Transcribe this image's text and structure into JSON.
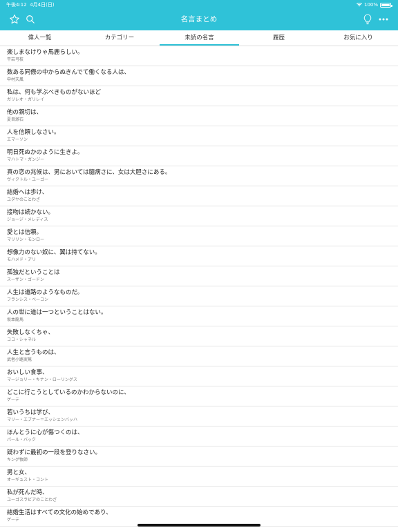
{
  "status_bar": {
    "time": "午後4:12",
    "date": "4月4日(日)",
    "battery": "100%"
  },
  "navbar": {
    "title": "名言まとめ"
  },
  "tabs": [
    "偉人一覧",
    "カテゴリー",
    "未読の名言",
    "履歴",
    "お気に入り"
  ],
  "selected_tab": "未読の名言",
  "quotes": [
    {
      "text": "楽しまなけりゃ馬鹿らしい。",
      "author": "平岩弓枝"
    },
    {
      "text": "数ある同僚の中からぬきんでて働くなる人は、",
      "author": "中村天風"
    },
    {
      "text": "私は、何も学ぶべきものがないほど",
      "author": "ガリレオ・ガリレイ"
    },
    {
      "text": "他の親切は、",
      "author": "夏目漱石"
    },
    {
      "text": "人を信頼しなさい。",
      "author": "エマーソン"
    },
    {
      "text": "明日死ぬかのように生きよ。",
      "author": "マハトマ・ガンジー"
    },
    {
      "text": "真の恋の兆候は、男においては臆病さに、女は大胆さにある。",
      "author": "ヴィクトル・ユーゴー"
    },
    {
      "text": "結婚へは歩け、",
      "author": "ユダヤのことわざ"
    },
    {
      "text": "接吻は続かない。",
      "author": "ジョージ・メレディス"
    },
    {
      "text": "愛とは信頼。",
      "author": "マリリン・モンロー"
    },
    {
      "text": "想像力のない奴に、翼は持てない。",
      "author": "モハメド・アリ"
    },
    {
      "text": "孤独だということは",
      "author": "スーザン・ゴードン"
    },
    {
      "text": "人生は道路のようなものだ。",
      "author": "フランシス・ベーコン"
    },
    {
      "text": "人の世に道は一つということはない。",
      "author": "坂本龍馬"
    },
    {
      "text": "失敗しなくちゃ、",
      "author": "ココ・シャネル"
    },
    {
      "text": "人生と言うものは、",
      "author": "武者小路実篤"
    },
    {
      "text": "おいしい食事、",
      "author": "マージョリー・キナン・ローリングス"
    },
    {
      "text": "どこに行こうとしているのかわからないのに、",
      "author": "ゲーテ"
    },
    {
      "text": "若いうちは学び、",
      "author": "マリー・エブナー＝エッシェンバッハ"
    },
    {
      "text": "ほんとうに心が傷つくのは、",
      "author": "パール・バック"
    },
    {
      "text": "疑わずに最初の一段を登りなさい。",
      "author": "キング牧師"
    },
    {
      "text": "男と女、",
      "author": "オーギュスト・コント"
    },
    {
      "text": "私が死んだ時、",
      "author": "ユーゴスラビアのことわざ"
    },
    {
      "text": "結婚生活はすべての文化の始めであり、",
      "author": "ゲーテ"
    }
  ],
  "colors": {
    "accent": "#2fc2d8"
  },
  "icons": [
    "star-icon",
    "search-icon",
    "lightbulb-icon",
    "more-icon"
  ]
}
